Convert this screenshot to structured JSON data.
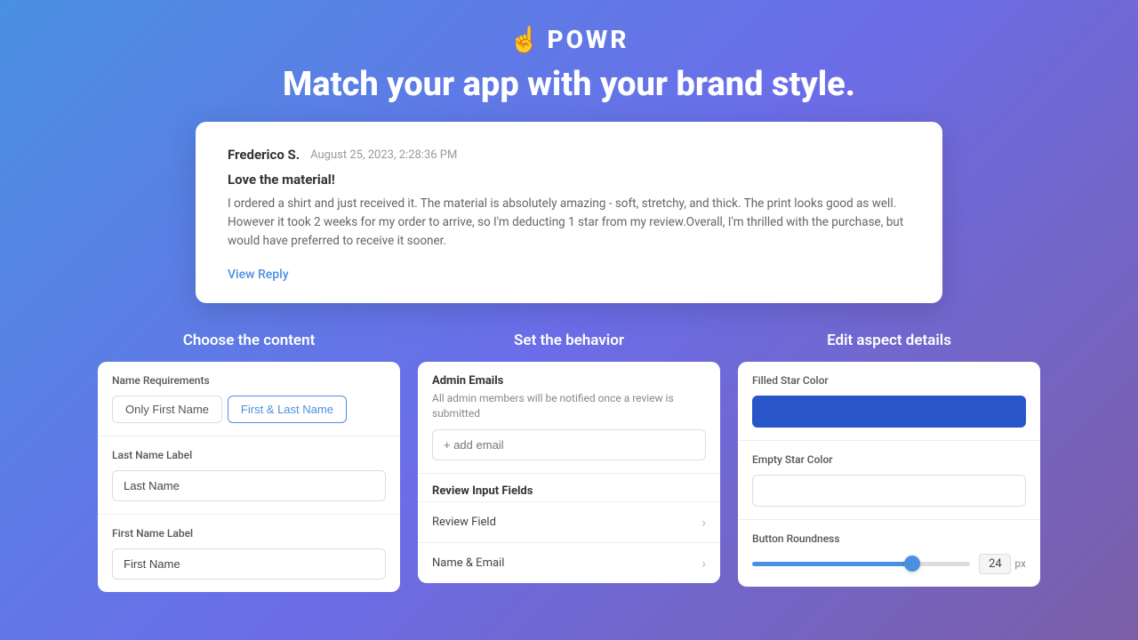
{
  "header": {
    "logo_icon": "☝",
    "logo_text": "POWR",
    "title": "Match your app with your brand style."
  },
  "review_card": {
    "reviewer_name": "Frederico S.",
    "review_date": "August 25, 2023, 2:28:36 PM",
    "review_title": "Love the material!",
    "review_body": "I ordered a shirt and just received it. The material is absolutely amazing - soft, stretchy, and thick. The print looks good as well. However it took 2 weeks for my order to arrive, so I'm deducting 1 star from my review.Overall, I'm thrilled with the purchase, but would have preferred to receive it sooner.",
    "view_reply_label": "View Reply"
  },
  "content_panel": {
    "title": "Choose the content",
    "name_requirements_label": "Name Requirements",
    "btn_only_first": "Only First Name",
    "btn_first_last": "First & Last Name",
    "last_name_label": "Last Name Label",
    "last_name_placeholder": "Last Name",
    "first_name_label": "First Name Label",
    "first_name_placeholder": "First Name"
  },
  "behavior_panel": {
    "title": "Set the behavior",
    "admin_emails_title": "Admin Emails",
    "admin_emails_desc": "All admin members will be notified once a review is submitted",
    "add_email_placeholder": "+ add email",
    "review_input_fields_title": "Review Input Fields",
    "fields": [
      {
        "label": "Review Field"
      },
      {
        "label": "Name & Email"
      }
    ]
  },
  "aspect_panel": {
    "title": "Edit aspect details",
    "filled_star_color_label": "Filled Star Color",
    "filled_star_color": "#2855c8",
    "empty_star_color_label": "Empty Star Color",
    "empty_star_color": "#ffffff",
    "button_roundness_label": "Button Roundness",
    "slider_value": "24",
    "slider_unit": "px"
  }
}
